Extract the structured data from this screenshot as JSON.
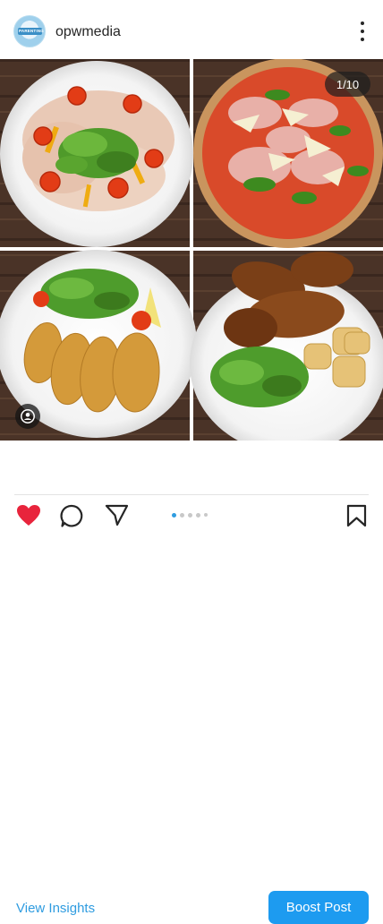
{
  "post": {
    "username": "opwmedia",
    "avatar_text": "PARENTING",
    "counter": "1/10"
  },
  "actions": {
    "view_insights": "View Insights",
    "boost_post": "Boost Post"
  },
  "carousel": {
    "total_dots": 5,
    "active_index": 0
  },
  "colors": {
    "accent_blue": "#1d9bf0",
    "like_red": "#e8243c"
  },
  "icons": [
    "more-options-icon",
    "user-tag-icon",
    "heart-icon",
    "comment-icon",
    "share-icon",
    "bookmark-icon"
  ]
}
